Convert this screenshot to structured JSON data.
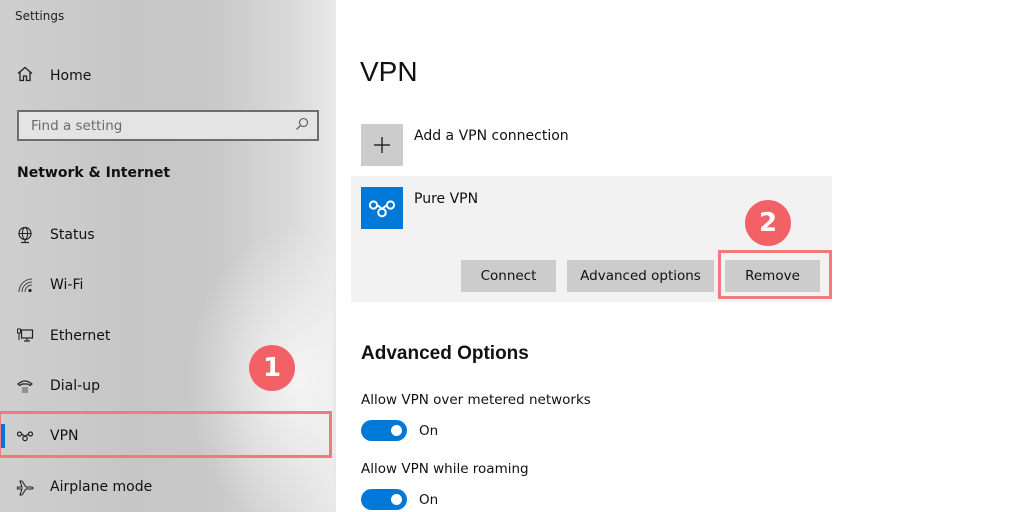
{
  "app": {
    "title": "Settings"
  },
  "sidebar": {
    "home_label": "Home",
    "search": {
      "placeholder": "Find a setting",
      "value": ""
    },
    "section_heading": "Network & Internet",
    "items": [
      {
        "label": "Status",
        "icon": "globe-icon",
        "active": false
      },
      {
        "label": "Wi-Fi",
        "icon": "wifi-icon",
        "active": false
      },
      {
        "label": "Ethernet",
        "icon": "ethernet-icon",
        "active": false
      },
      {
        "label": "Dial-up",
        "icon": "dialup-icon",
        "active": false
      },
      {
        "label": "VPN",
        "icon": "vpn-icon",
        "active": true
      },
      {
        "label": "Airplane mode",
        "icon": "airplane-icon",
        "active": false
      }
    ]
  },
  "main": {
    "title": "VPN",
    "add_connection_label": "Add a VPN connection",
    "connection": {
      "name": "Pure VPN",
      "buttons": {
        "connect": "Connect",
        "advanced": "Advanced options",
        "remove": "Remove"
      }
    },
    "advanced": {
      "heading": "Advanced Options",
      "options": [
        {
          "label": "Allow VPN over metered networks",
          "state": "On",
          "enabled": true
        },
        {
          "label": "Allow VPN while roaming",
          "state": "On",
          "enabled": true
        }
      ]
    }
  },
  "annotations": {
    "step1": "1",
    "step2": "2"
  },
  "colors": {
    "accent": "#0078d7",
    "annotation": "#f26166",
    "highlight_border": "#f07a7e"
  }
}
